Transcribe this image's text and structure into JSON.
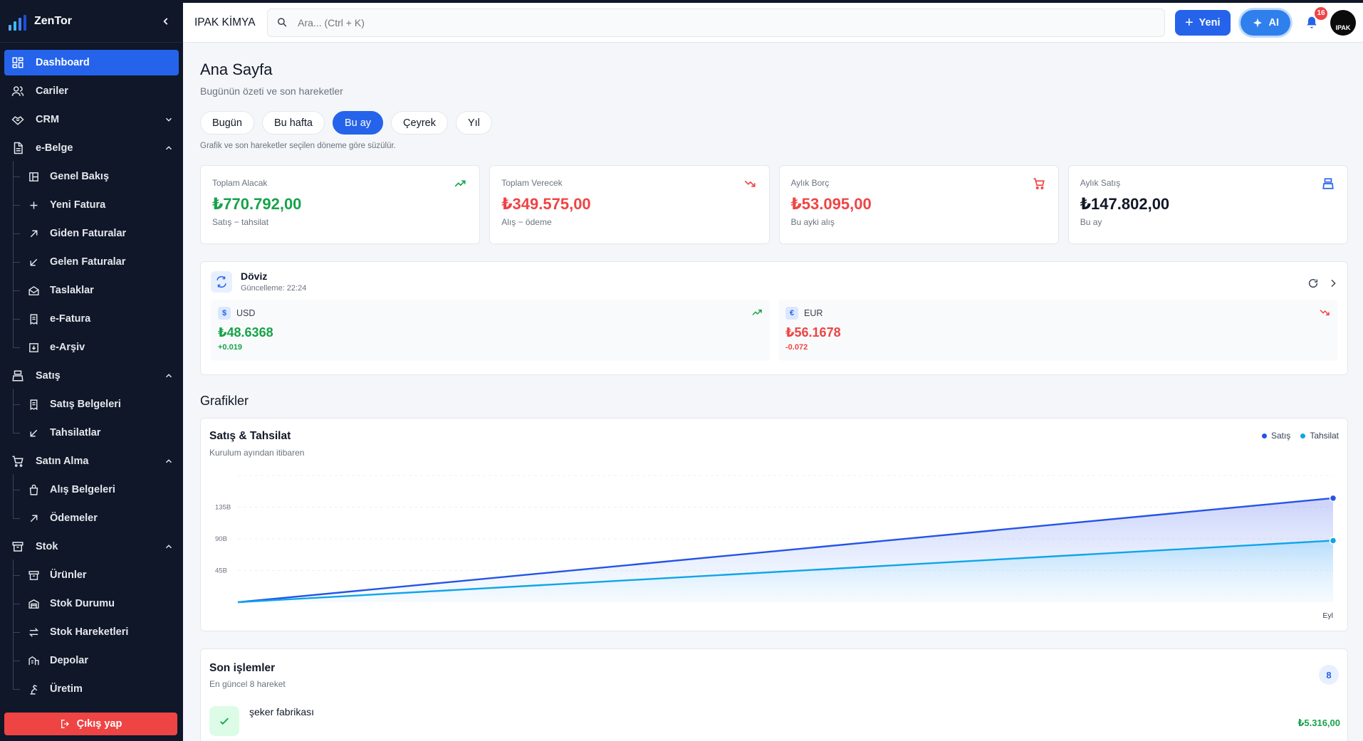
{
  "app": {
    "name": "ZenTor"
  },
  "sidebar": {
    "items": [
      {
        "label": "Dashboard"
      },
      {
        "label": "Cariler"
      },
      {
        "label": "CRM"
      },
      {
        "label": "e-Belge"
      },
      {
        "label": "Genel Bakış"
      },
      {
        "label": "Yeni Fatura"
      },
      {
        "label": "Giden Faturalar"
      },
      {
        "label": "Gelen Faturalar"
      },
      {
        "label": "Taslaklar"
      },
      {
        "label": "e-Fatura"
      },
      {
        "label": "e-Arşiv"
      },
      {
        "label": "Satış"
      },
      {
        "label": "Satış Belgeleri"
      },
      {
        "label": "Tahsilatlar"
      },
      {
        "label": "Satın Alma"
      },
      {
        "label": "Alış Belgeleri"
      },
      {
        "label": "Ödemeler"
      },
      {
        "label": "Stok"
      },
      {
        "label": "Ürünler"
      },
      {
        "label": "Stok Durumu"
      },
      {
        "label": "Stok Hareketleri"
      },
      {
        "label": "Depolar"
      },
      {
        "label": "Üretim"
      }
    ],
    "logout_label": "Çıkış yap"
  },
  "topbar": {
    "company": "IPAK KİMYA",
    "search_placeholder": "Ara... (Ctrl + K)",
    "new_label": "Yeni",
    "ai_label": "AI",
    "notification_count": "16",
    "avatar_text": "IPAK"
  },
  "page": {
    "title": "Ana Sayfa",
    "subtitle": "Bugünün özeti ve son hareketler",
    "periods": [
      "Bugün",
      "Bu hafta",
      "Bu ay",
      "Çeyrek",
      "Yıl"
    ],
    "active_period": "Bu ay",
    "period_note": "Grafik ve son hareketler seçilen döneme göre süzülür."
  },
  "kpis": [
    {
      "label": "Toplam Alacak",
      "value": "₺770.792,00",
      "sub": "Satış − tahsilat",
      "icon": "trending-up-icon",
      "color": "#16a34a"
    },
    {
      "label": "Toplam Verecek",
      "value": "₺349.575,00",
      "sub": "Alış − ödeme",
      "icon": "trending-down-icon",
      "color": "#ef4444"
    },
    {
      "label": "Aylık Borç",
      "value": "₺53.095,00",
      "sub": "Bu ayki alış",
      "icon": "cart-icon",
      "color": "#ef4444"
    },
    {
      "label": "Aylık Satış",
      "value": "₺147.802,00",
      "sub": "Bu ay",
      "icon": "register-icon",
      "color": "#111827"
    }
  ],
  "fx": {
    "title": "Döviz",
    "updated": "Güncelleme: 22:24",
    "rates": [
      {
        "symbol": "$",
        "code": "USD",
        "value": "₺48.6368",
        "delta": "+0.019",
        "trend": "up"
      },
      {
        "symbol": "€",
        "code": "EUR",
        "value": "₺56.1678",
        "delta": "-0.072",
        "trend": "down"
      }
    ]
  },
  "charts_section": {
    "title": "Grafikler"
  },
  "chart_data": {
    "type": "area",
    "title": "Satış & Tahsilat",
    "subtitle": "Kurulum ayından itibaren",
    "y_ticks": [
      "45B",
      "90B",
      "135B"
    ],
    "y_tick_values": [
      45,
      90,
      135
    ],
    "ylim": [
      0,
      180
    ],
    "x_labels": [
      "",
      "Eyl"
    ],
    "x": [
      0,
      1
    ],
    "series": [
      {
        "name": "Satış",
        "values": [
          0,
          147.8
        ],
        "color": "#2454e6"
      },
      {
        "name": "Tahsilat",
        "values": [
          0,
          87.5
        ],
        "color": "#0ea5e9"
      }
    ],
    "grid": true,
    "legend": "top-right"
  },
  "transactions": {
    "title": "Son işlemler",
    "subtitle": "En güncel 8 hareket",
    "count": "8",
    "items": [
      {
        "name": "şeker fabrikası",
        "amount": "₺5.316,00"
      }
    ]
  }
}
